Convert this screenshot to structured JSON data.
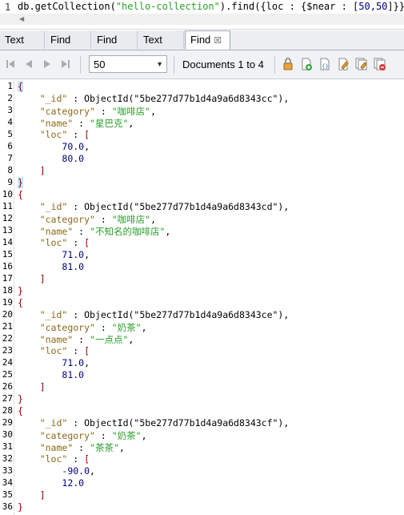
{
  "query": {
    "line_number": "1",
    "prefix": "db.getCollection(",
    "collection": "\"hello-collection\"",
    "middle": ").find({loc : {$near : [",
    "coords": "50,50",
    "suffix": "]}});"
  },
  "tabs": [
    {
      "label": "Text",
      "active": false
    },
    {
      "label": "Find",
      "active": false
    },
    {
      "label": "Find",
      "active": false
    },
    {
      "label": "Text",
      "active": false
    },
    {
      "label": "Find",
      "active": true
    }
  ],
  "toolbar": {
    "page_size": "50",
    "documents_info": "Documents 1 to 4"
  },
  "documents": [
    {
      "id": "ObjectId(\"5be277d77b1d4a9a6d8343cc\")",
      "category": "\"咖啡店\"",
      "name": "\"星巴克\"",
      "loc": [
        "70.0",
        "80.0"
      ]
    },
    {
      "id": "ObjectId(\"5be277d77b1d4a9a6d8343cd\")",
      "category": "\"咖啡店\"",
      "name": "\"不知名的咖啡店\"",
      "loc": [
        "71.0",
        "81.0"
      ]
    },
    {
      "id": "ObjectId(\"5be277d77b1d4a9a6d8343ce\")",
      "category": "\"奶茶\"",
      "name": "\"一点点\"",
      "loc": [
        "71.0",
        "81.0"
      ]
    },
    {
      "id": "ObjectId(\"5be277d77b1d4a9a6d8343cf\")",
      "category": "\"奶茶\"",
      "name": "\"茶茶\"",
      "loc": [
        "-90.0",
        "12.0"
      ]
    }
  ],
  "keys": {
    "id": "\"_id\"",
    "category": "\"category\"",
    "name": "\"name\"",
    "loc": "\"loc\""
  }
}
